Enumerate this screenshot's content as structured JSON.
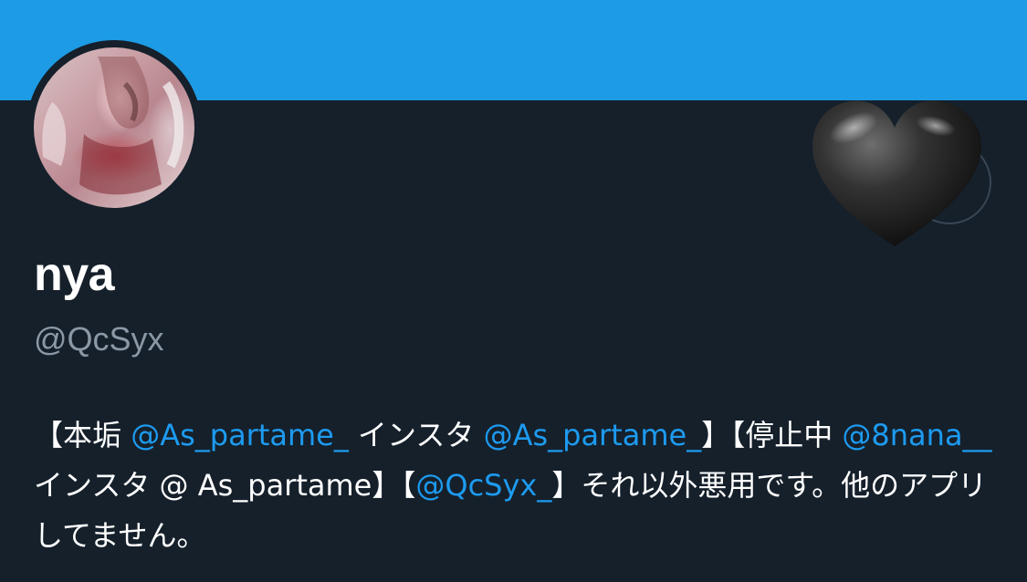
{
  "profile": {
    "display_name": "nya",
    "handle": "@QcSyx",
    "banner_color": "#1d9be4",
    "avatar_icon": "profile-photo",
    "badge_icon": "black-heart-emoji"
  },
  "bio": {
    "segments": [
      {
        "text": "【本垢 ",
        "type": "text"
      },
      {
        "text": "@As_partame_",
        "type": "mention"
      },
      {
        "text": " インスタ ",
        "type": "text"
      },
      {
        "text": "@As_partame_",
        "type": "mention"
      },
      {
        "text": "】【停止中 ",
        "type": "text"
      },
      {
        "text": "@8nana__",
        "type": "mention"
      },
      {
        "text": " インスタ @ As_partame】【",
        "type": "text"
      },
      {
        "text": "@QcSyx_",
        "type": "mention"
      },
      {
        "text": "】それ以外悪用です。他のアプリしてません。",
        "type": "text"
      }
    ]
  }
}
